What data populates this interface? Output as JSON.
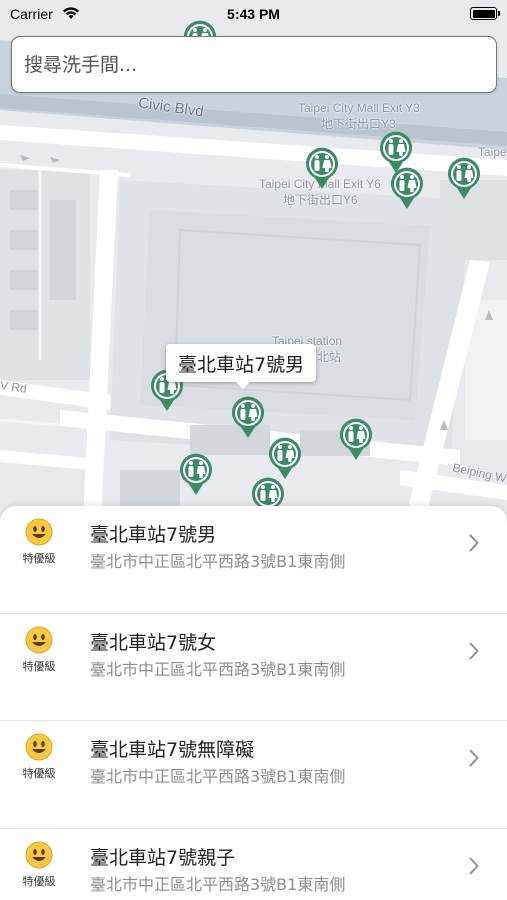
{
  "status_bar": {
    "carrier": "Carrier",
    "time": "5:43 PM"
  },
  "search": {
    "placeholder": "搜尋洗手間..."
  },
  "map": {
    "labels": {
      "civic_blvd": "Civic Blvd",
      "mall_y3_en": "Taipei City Mall Exit Y3",
      "mall_y3_zh": "地下街出口Y3",
      "mall_y6_en": "Taipei City Mall Exit Y6",
      "mall_y6_zh": "地下街出口Y6",
      "taipei_city_edge": "Taipei Ci",
      "station_en": "Taipei station",
      "station_zh": "台北站",
      "west_rd": "V Rd",
      "beiping_w": "Beiping W"
    },
    "callout": "臺北車站7號男",
    "pin_color": "#3d8a66"
  },
  "toilets": [
    {
      "name": "臺北車站7號男",
      "address": "臺北市中正區北平西路3號B1東南側",
      "rating": "特優級"
    },
    {
      "name": "臺北車站7號女",
      "address": "臺北市中正區北平西路3號B1東南側",
      "rating": "特優級"
    },
    {
      "name": "臺北車站7號無障礙",
      "address": "臺北市中正區北平西路3號B1東南側",
      "rating": "特優級"
    },
    {
      "name": "臺北車站7號親子",
      "address": "臺北市中正區北平西路3號B1東南側",
      "rating": "特優級"
    }
  ]
}
